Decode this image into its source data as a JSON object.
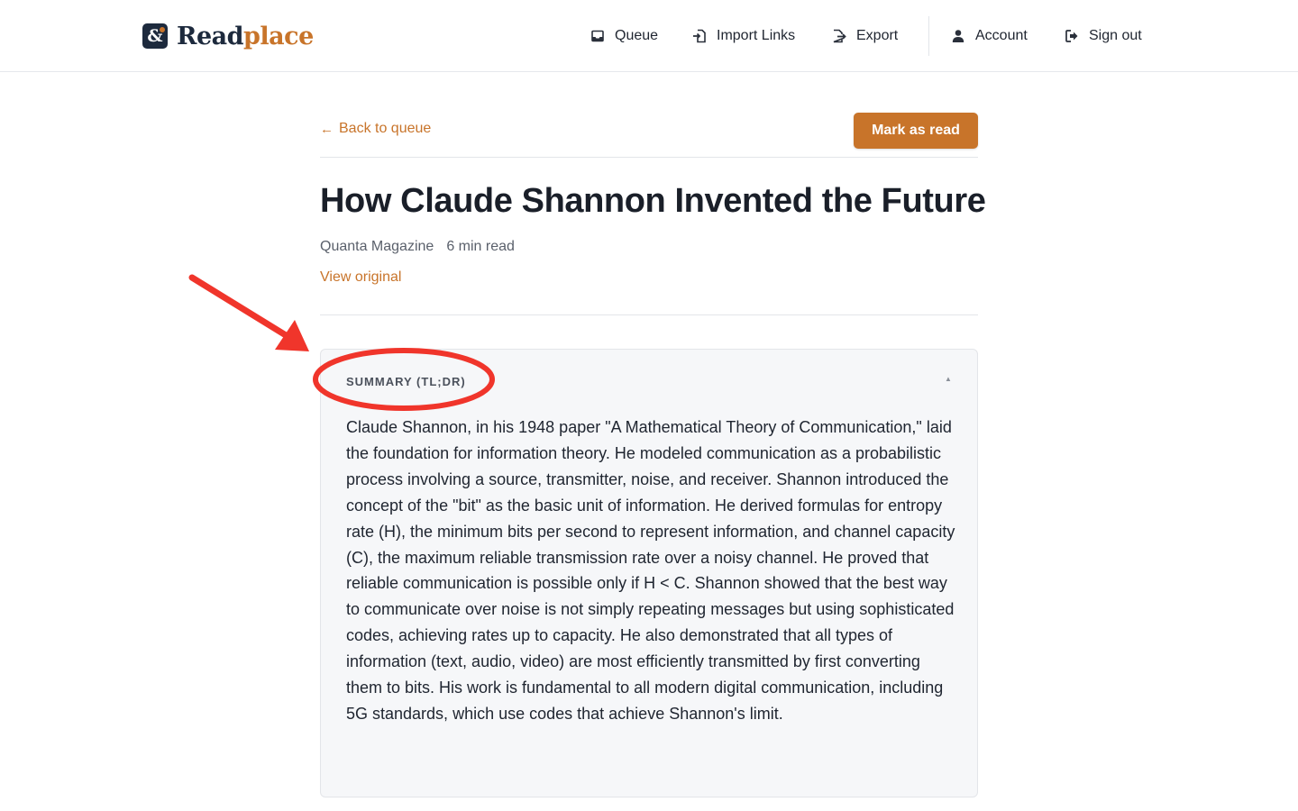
{
  "brand": {
    "mark": "&",
    "name_part1": "Read",
    "name_part2": "place",
    "accent_color": "#c8742a",
    "dark_color": "#1d2a3d"
  },
  "nav": {
    "items": [
      {
        "label": "Queue",
        "icon": "inbox-icon"
      },
      {
        "label": "Import Links",
        "icon": "import-icon"
      },
      {
        "label": "Export",
        "icon": "export-icon"
      },
      {
        "label": "Account",
        "icon": "user-icon"
      },
      {
        "label": "Sign out",
        "icon": "sign-out-icon"
      }
    ]
  },
  "toolbar": {
    "back_arrow": "←",
    "back_label": "Back to queue",
    "mark_read_label": "Mark as read"
  },
  "article": {
    "title": "How Claude Shannon Invented the Future",
    "source": "Quanta Magazine",
    "read_time": "6 min read",
    "view_original_label": "View original"
  },
  "summary": {
    "label": "SUMMARY (TL;DR)",
    "toggle_glyph": "▲",
    "text": "Claude Shannon, in his 1948 paper \"A Mathematical Theory of Communication,\" laid the foundation for information theory. He modeled communication as a probabilistic process involving a source, transmitter, noise, and receiver. Shannon introduced the concept of the \"bit\" as the basic unit of information. He derived formulas for entropy rate (H), the minimum bits per second to represent information, and channel capacity (C), the maximum reliable transmission rate over a noisy channel. He proved that reliable communication is possible only if H < C. Shannon showed that the best way to communicate over noise is not simply repeating messages but using sophisticated codes, achieving rates up to capacity. He also demonstrated that all types of information (text, audio, video) are most efficiently transmitted by first converting them to bits. His work is fundamental to all modern digital communication, including 5G standards, which use codes that achieve Shannon's limit."
  },
  "annotation": {
    "color": "#f0352b"
  }
}
